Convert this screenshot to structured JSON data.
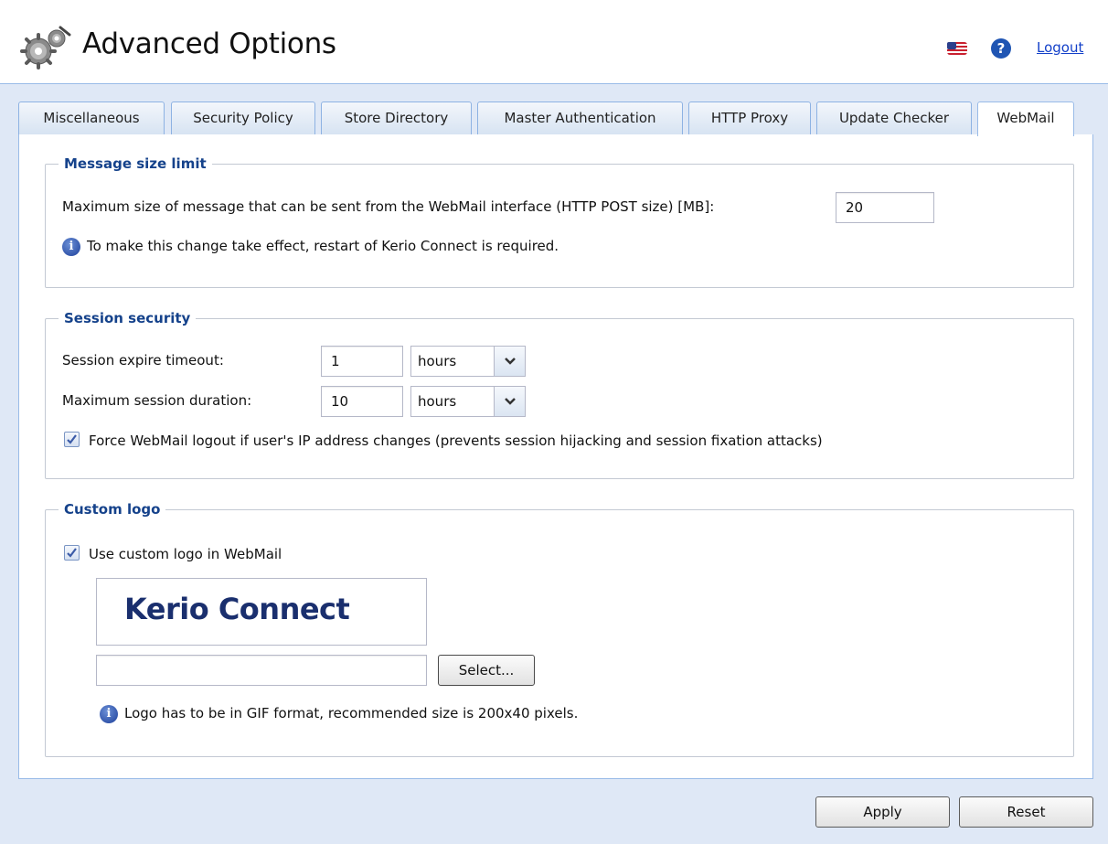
{
  "header": {
    "title": "Advanced Options",
    "logout_label": "Logout",
    "help_glyph": "?",
    "app_icon": "gears-icon",
    "language_icon": "us-flag-icon"
  },
  "tabs": [
    {
      "label": "Miscellaneous",
      "active": false
    },
    {
      "label": "Security Policy",
      "active": false
    },
    {
      "label": "Store Directory",
      "active": false
    },
    {
      "label": "Master Authentication",
      "active": false
    },
    {
      "label": "HTTP Proxy",
      "active": false
    },
    {
      "label": "Update Checker",
      "active": false
    },
    {
      "label": "WebMail",
      "active": true
    }
  ],
  "message_size": {
    "legend": "Message size limit",
    "label": "Maximum size of message that can be sent from the WebMail interface (HTTP POST size) [MB]:",
    "value": "20",
    "note": "To make this change take effect, restart of Kerio Connect is required."
  },
  "session_security": {
    "legend": "Session security",
    "expire_label": "Session expire timeout:",
    "expire_value": "1",
    "expire_unit": "hours",
    "duration_label": "Maximum session duration:",
    "duration_value": "10",
    "duration_unit": "hours",
    "force_logout_label": "Force WebMail logout if user's IP address changes (prevents session hijacking and session fixation attacks)",
    "force_logout_checked": true
  },
  "custom_logo": {
    "legend": "Custom logo",
    "use_logo_label": "Use custom logo in WebMail",
    "use_logo_checked": true,
    "logo_preview_text": "Kerio Connect",
    "file_path": "",
    "select_label": "Select...",
    "note": "Logo has to be in GIF format, recommended size is 200x40 pixels."
  },
  "footer": {
    "apply_label": "Apply",
    "reset_label": "Reset"
  },
  "colors": {
    "legend": "#15428b",
    "link": "#1340c9",
    "tab_border": "#8db2e3",
    "page_bg": "#dfe8f6"
  }
}
